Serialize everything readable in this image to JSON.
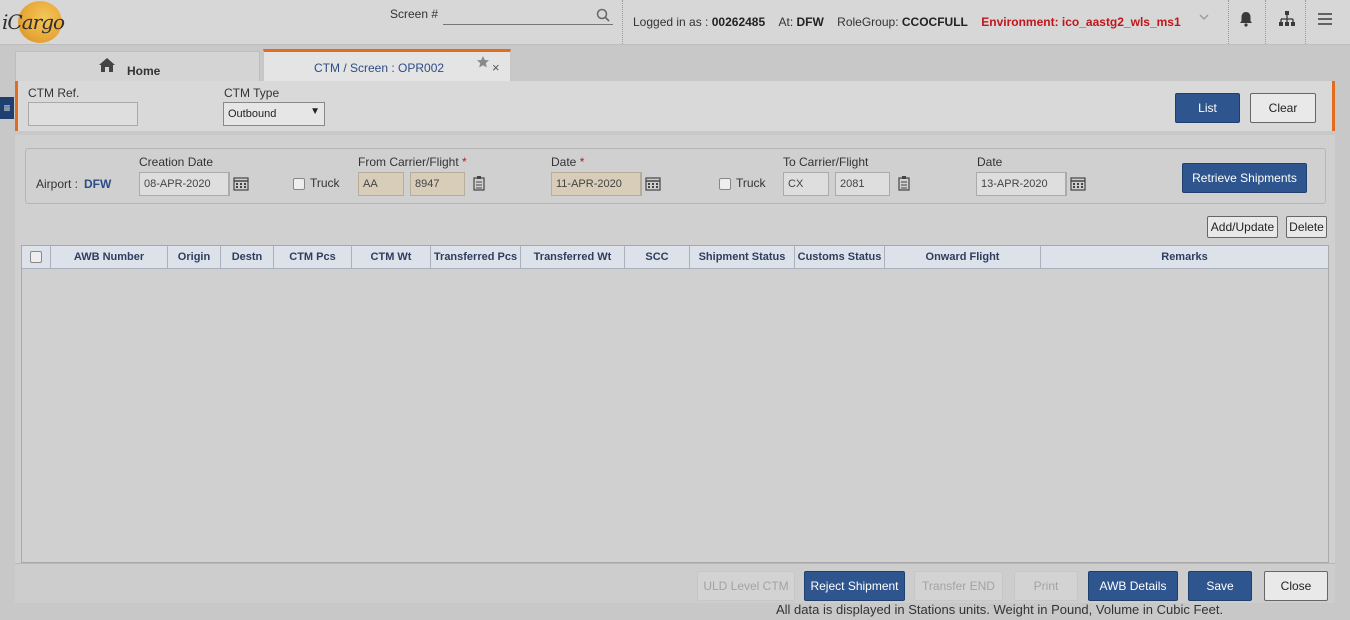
{
  "app": {
    "logo_text": "iCargo"
  },
  "topbar": {
    "screen_label": "Screen #",
    "screen_value": "",
    "logged_in_prefix": "Logged in as :",
    "user_id": "00262485",
    "at_prefix": "At:",
    "station": "DFW",
    "role_prefix": "RoleGroup:",
    "role": "CCOCFULL",
    "environment": "Environment: ico_aastg2_wls_ms1",
    "icons": [
      "search-icon",
      "chevron-down-icon",
      "bell-icon",
      "sitemap-icon",
      "menu-icon"
    ]
  },
  "tabs": {
    "home_label": "Home",
    "active_label": "CTM / Screen : OPR002",
    "close_glyph": "×"
  },
  "header_filter": {
    "ctm_ref_label": "CTM Ref.",
    "ctm_ref_value": "",
    "ctm_type_label": "CTM Type",
    "ctm_type_value": "Outbound",
    "list_button": "List",
    "clear_button": "Clear"
  },
  "criteria": {
    "airport_label": "Airport :",
    "airport_value": "DFW",
    "creation_date_label": "Creation Date",
    "creation_date_value": "08-APR-2020",
    "truck_label_1": "Truck",
    "from_carrier_label": "From Carrier/Flight",
    "from_carrier_value": "AA",
    "from_flight_value": "8947",
    "date_label_1": "Date",
    "date_value_1": "11-APR-2020",
    "truck_label_2": "Truck",
    "to_carrier_label": "To Carrier/Flight",
    "to_carrier_value": "CX",
    "to_flight_value": "2081",
    "date_label_2": "Date",
    "date_value_2": "13-APR-2020",
    "required_mark": "*",
    "retrieve_button": "Retrieve Shipments"
  },
  "table_actions": {
    "add_update": "Add/Update",
    "delete": "Delete"
  },
  "table": {
    "columns": [
      "AWB Number",
      "Origin",
      "Destn",
      "CTM Pcs",
      "CTM Wt",
      "Transferred Pcs",
      "Transferred Wt",
      "SCC",
      "Shipment Status",
      "Customs Status",
      "Onward Flight",
      "Remarks"
    ],
    "rows": []
  },
  "footer_buttons": {
    "uld_level_ctm": "ULD Level CTM",
    "reject_shipment": "Reject Shipment",
    "transfer_end": "Transfer END",
    "print": "Print",
    "awb_details": "AWB Details",
    "save": "Save",
    "close": "Close"
  },
  "status_note": "All data is displayed in Stations units. Weight in Pound, Volume in Cubic Feet.",
  "colors": {
    "accent": "#e36d1e",
    "primary": "#2e558e",
    "env_red": "#c0161b",
    "link_blue": "#2c4c86"
  }
}
